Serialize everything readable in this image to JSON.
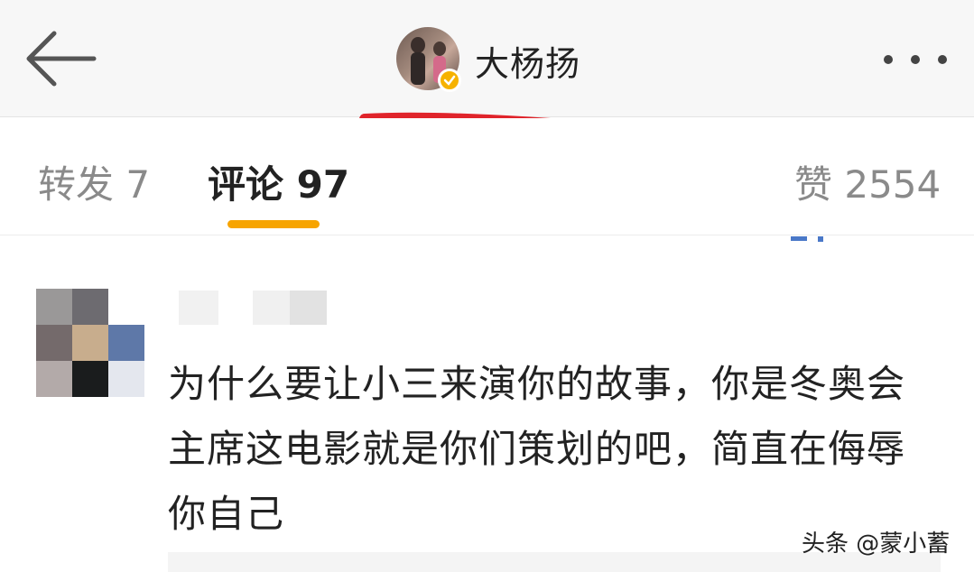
{
  "header": {
    "title": "大杨扬",
    "back_icon": "arrow-left-icon",
    "more_icon": "ellipsis-icon",
    "verified_icon": "verified-badge-icon",
    "accent": "#f6b200",
    "underline_color": "#e0242b"
  },
  "tabs": {
    "repost_label": "转发 7",
    "comments_label": "评论 97",
    "likes_label": "赞 2554",
    "active": "comments",
    "indicator_color": "#f7a400"
  },
  "comment": {
    "text": "为什么要让小三来演你的故事，你是冬奥会主席这电影就是你们策划的吧，简直在侮辱你自己"
  },
  "watermark": "头条 @蒙小蓄"
}
